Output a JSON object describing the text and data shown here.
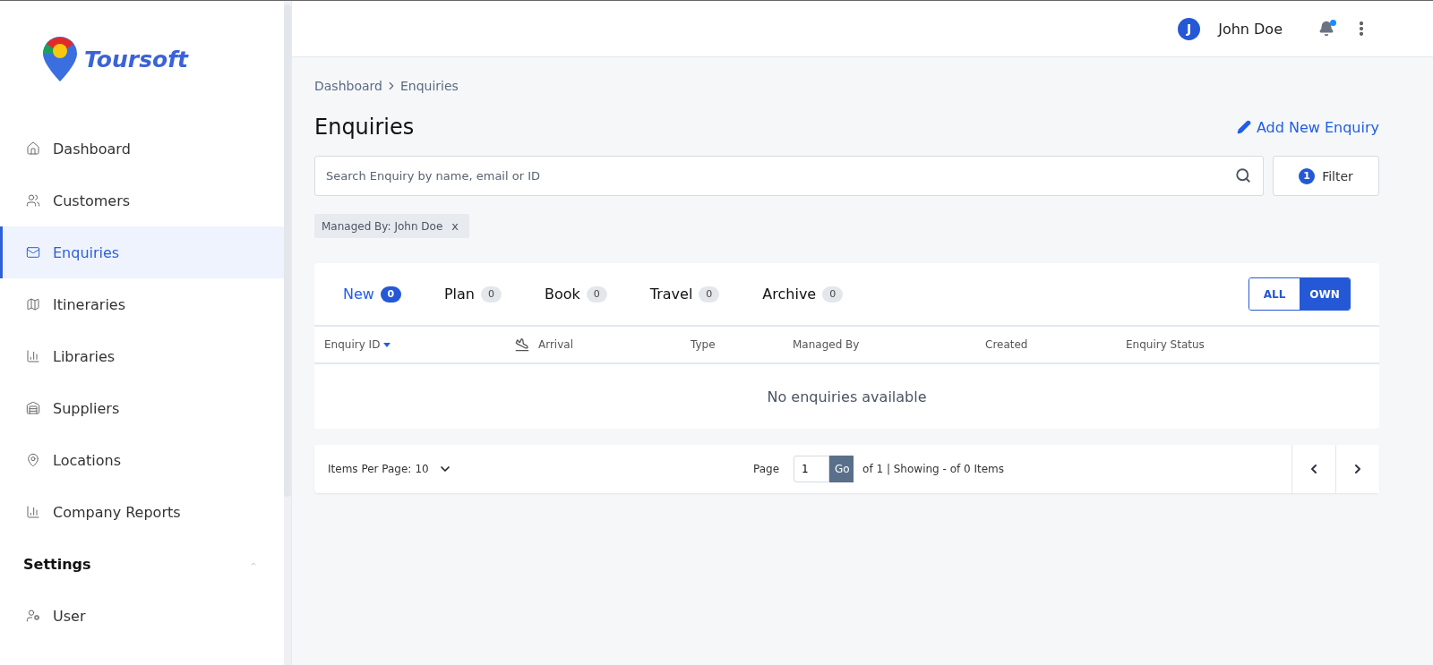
{
  "logo": {
    "text": "Toursoft"
  },
  "sidebar": {
    "items": [
      {
        "label": "Dashboard",
        "selected": false
      },
      {
        "label": "Customers",
        "selected": false
      },
      {
        "label": "Enquiries",
        "selected": true
      },
      {
        "label": "Itineraries",
        "selected": false
      },
      {
        "label": "Libraries",
        "selected": false
      },
      {
        "label": "Suppliers",
        "selected": false
      },
      {
        "label": "Locations",
        "selected": false
      },
      {
        "label": "Company Reports",
        "selected": false
      }
    ],
    "settings": {
      "label": "Settings",
      "expanded": true,
      "items": [
        {
          "label": "User",
          "selected": false
        }
      ]
    }
  },
  "header": {
    "avatar": "J",
    "user": "John Doe",
    "notification": true
  },
  "breadcrumb": [
    "Dashboard",
    "Enquiries"
  ],
  "title": "Enquiries",
  "add_button": "Add New Enquiry",
  "search": {
    "placeholder": "Search Enquiry by name, email or ID"
  },
  "filter": {
    "count": "1",
    "label": "Filter"
  },
  "chips": [
    {
      "label": "Managed By: John Doe",
      "remove": "x"
    }
  ],
  "tabs": [
    {
      "label": "New",
      "count": "0",
      "selected": true
    },
    {
      "label": "Plan",
      "count": "0",
      "selected": false
    },
    {
      "label": "Book",
      "count": "0",
      "selected": false
    },
    {
      "label": "Travel",
      "count": "0",
      "selected": false
    },
    {
      "label": "Archive",
      "count": "0",
      "selected": false
    }
  ],
  "scope_toggle": [
    {
      "label": "ALL",
      "selected": false
    },
    {
      "label": "OWN",
      "selected": true
    }
  ],
  "table": {
    "columns": [
      {
        "label": "Enquiry ID",
        "sorted": true
      },
      {
        "label": "Arrival",
        "sorted": false
      },
      {
        "label": "Type",
        "sorted": false
      },
      {
        "label": "Managed By",
        "sorted": false
      },
      {
        "label": "Created",
        "sorted": false
      },
      {
        "label": "Enquiry Status",
        "sorted": false
      }
    ],
    "empty": "No enquiries available"
  },
  "pagination": {
    "per_page_label": "Items Per Page:",
    "per_page": "10",
    "page_label": "Page",
    "page": "1",
    "go": "Go",
    "summary": "of 1 | Showing - of 0 Items"
  }
}
